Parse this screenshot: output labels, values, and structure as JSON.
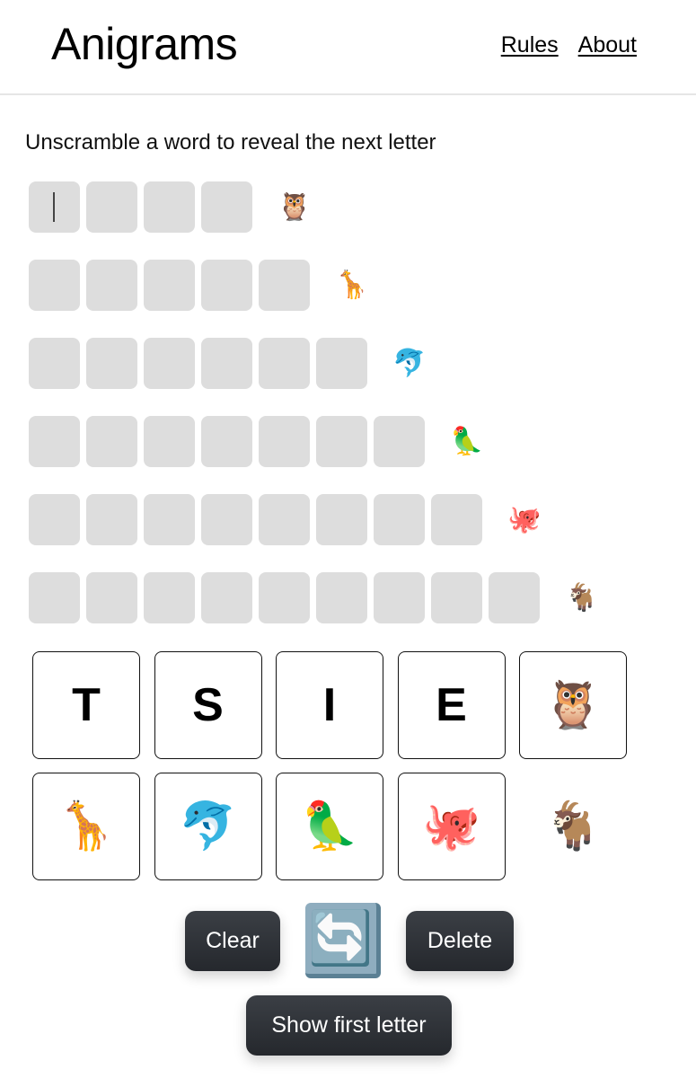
{
  "header": {
    "title": "Anigrams",
    "nav": [
      {
        "label": "Rules"
      },
      {
        "label": "About"
      }
    ]
  },
  "instruction": "Unscramble a word to reveal the next letter",
  "rows": [
    {
      "length": 4,
      "animal": "owl",
      "emoji": "🦉",
      "active_slot": 0
    },
    {
      "length": 5,
      "animal": "giraffe",
      "emoji": "🦒"
    },
    {
      "length": 6,
      "animal": "dolphin",
      "emoji": "🐬"
    },
    {
      "length": 7,
      "animal": "parrot",
      "emoji": "🦜"
    },
    {
      "length": 8,
      "animal": "octopus",
      "emoji": "🐙"
    },
    {
      "length": 9,
      "animal": "goat",
      "emoji": "🐐"
    }
  ],
  "tiles": [
    {
      "type": "letter",
      "value": "T"
    },
    {
      "type": "letter",
      "value": "S"
    },
    {
      "type": "letter",
      "value": "I"
    },
    {
      "type": "letter",
      "value": "E"
    },
    {
      "type": "emoji",
      "value": "🦉",
      "animal": "owl"
    },
    {
      "type": "emoji",
      "value": "🦒",
      "animal": "giraffe"
    },
    {
      "type": "emoji",
      "value": "🐬",
      "animal": "dolphin"
    },
    {
      "type": "emoji",
      "value": "🦜",
      "animal": "parrot"
    },
    {
      "type": "emoji",
      "value": "🐙",
      "animal": "octopus"
    },
    {
      "type": "emoji",
      "value": "🐐",
      "animal": "goat",
      "bordered": false
    }
  ],
  "controls": {
    "clear_label": "Clear",
    "shuffle_icon": "🔄",
    "delete_label": "Delete",
    "show_first_letter_label": "Show first letter"
  }
}
